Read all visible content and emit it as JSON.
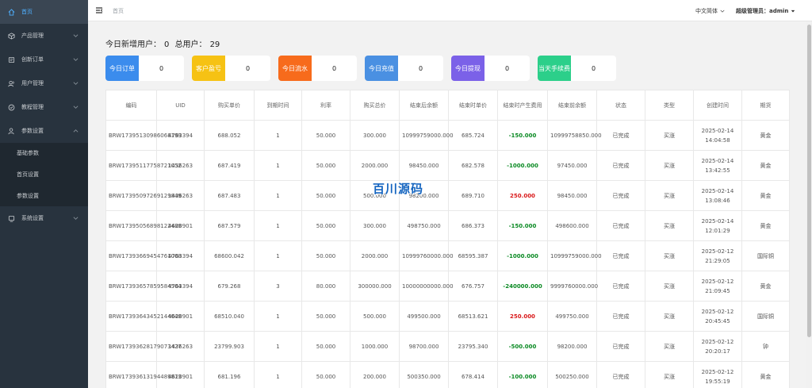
{
  "sidebar": {
    "items": [
      {
        "label": "首页",
        "icon": "home-icon",
        "active": true
      },
      {
        "label": "产品管理",
        "icon": "cube-icon"
      },
      {
        "label": "创新订单",
        "icon": "order-icon"
      },
      {
        "label": "用户管理",
        "icon": "users-icon"
      },
      {
        "label": "教程管理",
        "icon": "book-icon"
      },
      {
        "label": "参数设置",
        "icon": "user-gear-icon",
        "expanded": true
      },
      {
        "label": "系统设置",
        "icon": "settings-icon"
      }
    ],
    "sub_items": [
      {
        "label": "基础参数"
      },
      {
        "label": "首页设置"
      },
      {
        "label": "参数设置"
      }
    ]
  },
  "header": {
    "breadcrumb": "首页",
    "language": "中文简体",
    "admin": "超级管理员：admin"
  },
  "stats": {
    "new_users_label": "今日新增用户：",
    "new_users_value": "0",
    "total_users_label": "总用户：",
    "total_users_value": "29"
  },
  "cards": [
    {
      "label": "今日订单",
      "value": "0",
      "color": "#3b8ced"
    },
    {
      "label": "客户盈亏",
      "value": "0",
      "color": "#f6c214"
    },
    {
      "label": "今日流水",
      "value": "0",
      "color": "#f76b1c"
    },
    {
      "label": "今日充值",
      "value": "0",
      "color": "#4a90e2"
    },
    {
      "label": "今日提现",
      "value": "0",
      "color": "#7b61e8"
    },
    {
      "label": "当天手续费",
      "value": "0",
      "color": "#2ccf8a"
    }
  ],
  "table": {
    "headers": [
      "编码",
      "UID",
      "购买单价",
      "到期时间",
      "利率",
      "购买总价",
      "结束后余额",
      "结束时单价",
      "结束时产生费用",
      "结束前余额",
      "状态",
      "类型",
      "创建时间",
      "期货"
    ],
    "rows": [
      [
        "BRW17395130986068199",
        "4763394",
        "688.052",
        "1",
        "50.000",
        "300.000",
        "10999759000.000",
        "685.724",
        "-150.000",
        "10999758850.000",
        "已完成",
        "买涨",
        "2025-02-14 14:04:58",
        "黄金"
      ],
      [
        "BRW17395117758721052",
        "1436263",
        "687.419",
        "1",
        "50.000",
        "2000.000",
        "98450.000",
        "682.578",
        "-1000.000",
        "97450.000",
        "已完成",
        "买涨",
        "2025-02-14 13:42:55",
        "黄金"
      ],
      [
        "BRW17395097269129849",
        "1436263",
        "687.483",
        "1",
        "50.000",
        "500.000",
        "98200.000",
        "689.710",
        "250.000",
        "98450.000",
        "已完成",
        "买涨",
        "2025-02-14 13:08:46",
        "黄金"
      ],
      [
        "BRW17395056898122488",
        "4620901",
        "687.579",
        "1",
        "50.000",
        "300.000",
        "498750.000",
        "686.373",
        "-150.000",
        "498600.000",
        "已完成",
        "买涨",
        "2025-02-14 12:01:29",
        "黄金"
      ],
      [
        "BRW17393669454761008",
        "4763394",
        "68600.042",
        "1",
        "50.000",
        "2000.000",
        "10999760000.000",
        "68595.387",
        "-1000.000",
        "10999759000.000",
        "已完成",
        "买涨",
        "2025-02-12 21:29:05",
        "国际铜"
      ],
      [
        "BRW17393657859584504",
        "4763394",
        "679.268",
        "3",
        "80.000",
        "300000.000",
        "10000000000.000",
        "676.757",
        "-240000.000",
        "9999760000.000",
        "已完成",
        "买涨",
        "2025-02-12 21:09:45",
        "黄金"
      ],
      [
        "BRW17393643452144048",
        "4620901",
        "68510.040",
        "1",
        "50.000",
        "500.000",
        "499500.000",
        "68513.621",
        "250.000",
        "499750.000",
        "已完成",
        "买涨",
        "2025-02-12 20:45:45",
        "国际铜"
      ],
      [
        "BRW17393628179073427",
        "1436263",
        "23799.903",
        "1",
        "50.000",
        "1000.000",
        "98700.000",
        "23795.340",
        "-500.000",
        "98200.000",
        "已完成",
        "买涨",
        "2025-02-12 20:20:17",
        "钟"
      ],
      [
        "BRW17393613194489813",
        "4620901",
        "681.196",
        "1",
        "50.000",
        "200.000",
        "500350.000",
        "678.414",
        "-100.000",
        "500250.000",
        "已完成",
        "买涨",
        "2025-02-12 19:55:19",
        "黄金"
      ]
    ]
  },
  "watermark": "百川源码"
}
